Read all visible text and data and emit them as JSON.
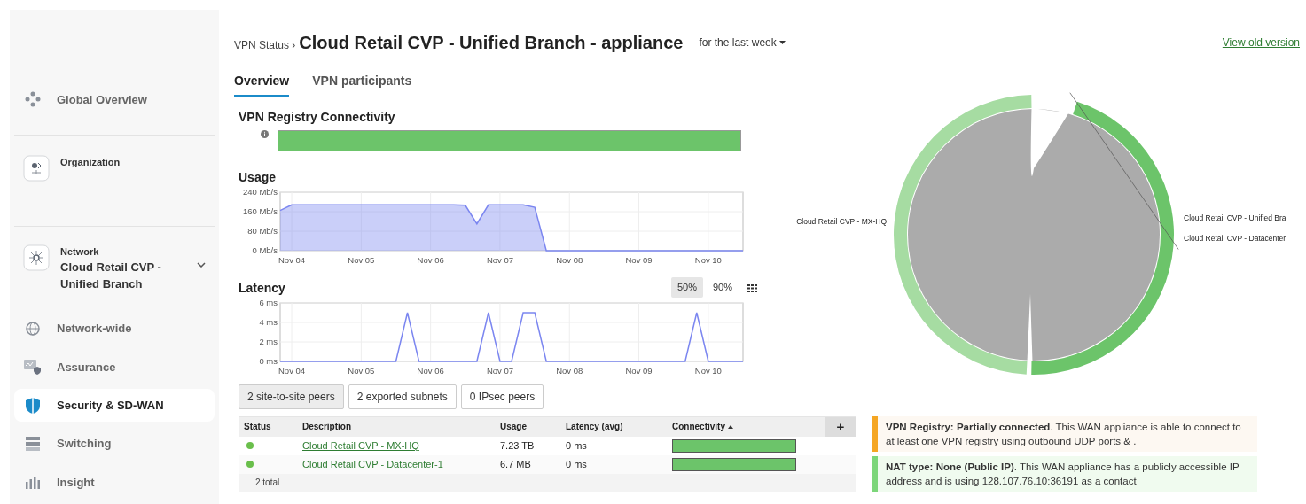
{
  "sidebar": {
    "items": [
      {
        "kind": "nav",
        "label": "Global Overview",
        "selected": false
      },
      {
        "kind": "context",
        "label": "Organization"
      },
      {
        "kind": "context",
        "label": "Network",
        "value": "Cloud Retail CVP - Unified Branch",
        "expandable": true
      },
      {
        "kind": "nav",
        "label": "Network-wide",
        "selected": false
      },
      {
        "kind": "nav",
        "label": "Assurance",
        "selected": false
      },
      {
        "kind": "nav",
        "label": "Security & SD-WAN",
        "selected": true
      },
      {
        "kind": "nav",
        "label": "Switching",
        "selected": false
      },
      {
        "kind": "nav",
        "label": "Insight",
        "selected": false
      }
    ]
  },
  "header": {
    "breadcrumb": "VPN Status ›",
    "title": "Cloud Retail CVP - Unified Branch - appliance",
    "timespan": "for the last week",
    "link": "View old version"
  },
  "tabs": [
    {
      "label": "Overview",
      "selected": true
    },
    {
      "label": "VPN participants",
      "selected": false
    }
  ],
  "registry": {
    "title": "VPN Registry Connectivity",
    "level": 1
  },
  "usage": {
    "title": "Usage",
    "chart_data": {
      "type": "area",
      "categories": [
        null,
        "Nov 04",
        null,
        null,
        null,
        null,
        null,
        "Nov 05",
        null,
        null,
        null,
        null,
        null,
        "Nov 06",
        null,
        null,
        null,
        null,
        null,
        "Nov 07",
        null,
        null,
        null,
        null,
        null,
        "Nov 08",
        null,
        null,
        null,
        null,
        null,
        "Nov 09",
        null,
        null,
        null,
        null,
        null,
        "Nov 10",
        null,
        null,
        null
      ],
      "grid": true,
      "series": [
        {
          "color": "#7b86f0",
          "values": [
            165,
            188,
            188,
            188,
            188,
            188,
            188,
            188,
            188,
            188,
            188,
            188,
            188,
            188,
            188,
            188,
            186,
            110,
            188,
            188,
            188,
            188,
            178,
            0,
            0,
            0,
            0,
            0,
            0,
            0,
            0,
            0,
            0,
            0,
            0,
            0,
            0,
            0,
            0,
            0,
            0
          ]
        }
      ],
      "ylim": [
        0,
        240
      ],
      "yticks": [
        {
          "value": 0,
          "label": "0 Mb/s"
        },
        {
          "value": 80,
          "label": "80 Mb/s"
        },
        {
          "value": 160,
          "label": "160 Mb/s"
        },
        {
          "value": 240,
          "label": "240 Mb/s"
        }
      ]
    }
  },
  "latency": {
    "title": "Latency",
    "percentiles": [
      {
        "label": "50%",
        "selected": true
      },
      {
        "label": "90%",
        "selected": false
      }
    ],
    "chart_data": {
      "type": "line",
      "categories": [
        null,
        "Nov 04",
        null,
        null,
        null,
        null,
        null,
        "Nov 05",
        null,
        null,
        null,
        null,
        null,
        "Nov 06",
        null,
        null,
        null,
        null,
        null,
        "Nov 07",
        null,
        null,
        null,
        null,
        null,
        "Nov 08",
        null,
        null,
        null,
        null,
        null,
        "Nov 09",
        null,
        null,
        null,
        null,
        null,
        "Nov 10",
        null,
        null,
        null
      ],
      "grid": true,
      "series": [
        {
          "color": "#7b86f0",
          "values": [
            0,
            0,
            0,
            0,
            0,
            0,
            0,
            0,
            0,
            0,
            0,
            5,
            0,
            0,
            0,
            0,
            0,
            0,
            5,
            0,
            0,
            5,
            5,
            0,
            0,
            0,
            0,
            0,
            0,
            0,
            0,
            0,
            0,
            0,
            0,
            0,
            5,
            0,
            0,
            0,
            0
          ]
        }
      ],
      "ylim": [
        0,
        6
      ],
      "yticks": [
        {
          "value": 0,
          "label": "0 ms"
        },
        {
          "value": 2,
          "label": "2 ms"
        },
        {
          "value": 4,
          "label": "4 ms"
        },
        {
          "value": 6,
          "label": "6 ms"
        }
      ]
    }
  },
  "peer_tabs": [
    {
      "label": "2 site-to-site peers",
      "selected": true
    },
    {
      "label": "2 exported subnets",
      "selected": false
    },
    {
      "label": "0 IPsec peers",
      "selected": false
    }
  ],
  "table": {
    "columns": [
      {
        "label": "Status",
        "sorted": false
      },
      {
        "label": "Description",
        "sorted": false
      },
      {
        "label": "Usage",
        "sorted": false
      },
      {
        "label": "Latency (avg)",
        "sorted": false
      },
      {
        "label": "Connectivity",
        "sorted": true
      }
    ],
    "add": "+",
    "rows": [
      {
        "color": "#6abf4b",
        "description": "Cloud Retail CVP - MX-HQ",
        "usage": "7.23 TB",
        "latency": "0 ms",
        "level": 1
      },
      {
        "color": "#6abf4b",
        "description": "Cloud Retail CVP - Datacenter-1",
        "usage": "6.7 MB",
        "latency": "0 ms",
        "level": 1
      }
    ],
    "footer": "2 total"
  },
  "chord": {
    "labels": [
      "Cloud Retail CVP - MX-HQ",
      "Cloud Retail CVP - Unified Bra",
      "Cloud Retail CVP - Datacenter"
    ]
  },
  "notices": [
    {
      "kind": "warning",
      "text": "**VPN Registry: Partially connected**. This WAN appliance is able to connect to at least one VPN registry using outbound UDP ports & ."
    },
    {
      "kind": "success",
      "text": "**NAT type: None (Public IP)**. This WAN appliance has a publicly accessible IP address and is using 128.107.76.10:36191 as a contact"
    }
  ]
}
